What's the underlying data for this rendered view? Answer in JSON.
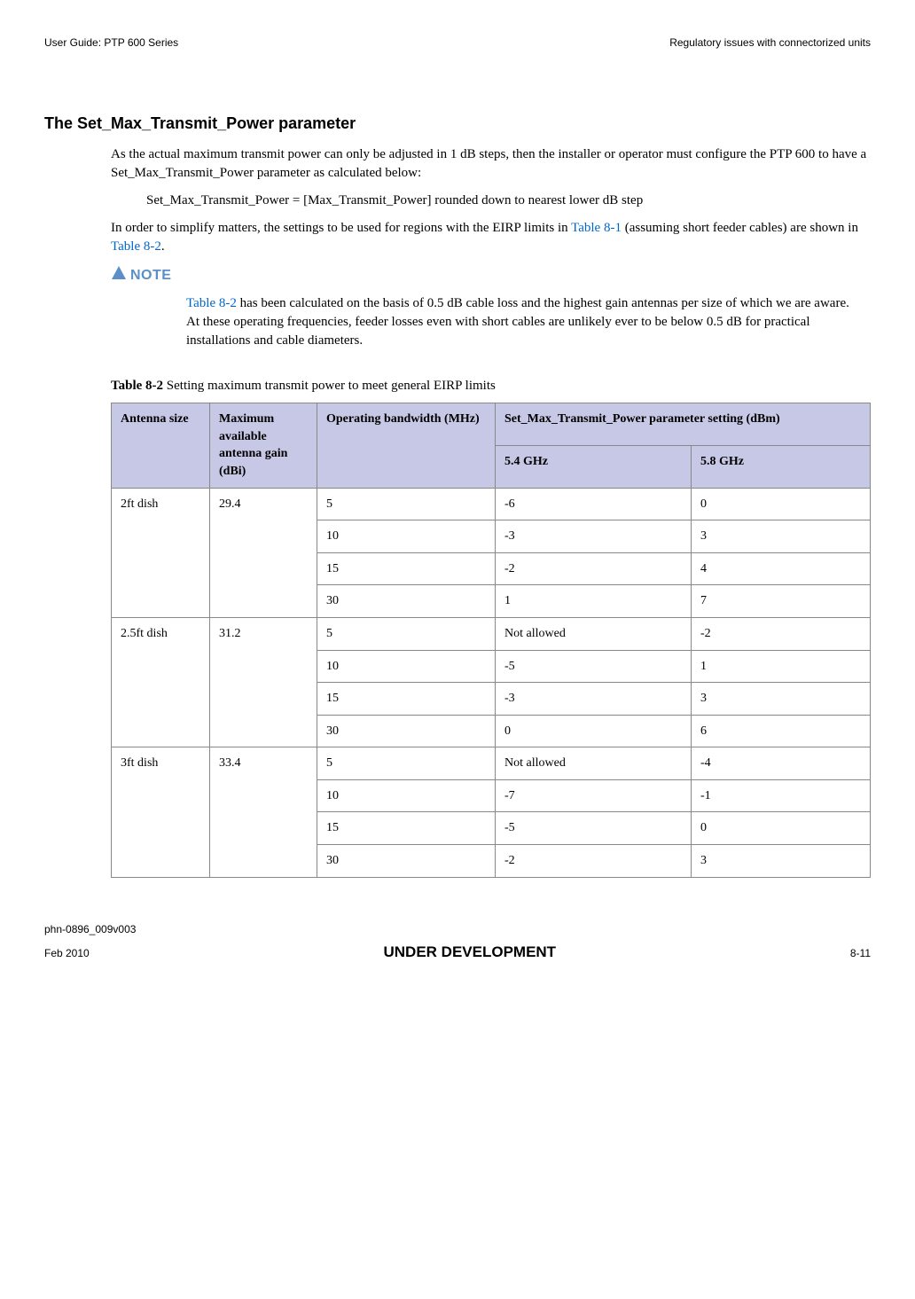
{
  "header": {
    "left": "User Guide: PTP 600 Series",
    "right": "Regulatory issues with connectorized units"
  },
  "section": {
    "heading": "The Set_Max_Transmit_Power parameter",
    "para1": "As the actual maximum transmit power can only be adjusted in 1 dB steps, then the installer or operator must configure the PTP 600 to have a Set_Max_Transmit_Power parameter as calculated below:",
    "formula": "Set_Max_Transmit_Power = [Max_Transmit_Power] rounded down to nearest lower dB step",
    "para2_pre": "In order to simplify matters, the settings to be used for regions with the EIRP limits in ",
    "para2_link1": "Table 8-1",
    "para2_mid": " (assuming short feeder cables) are shown in ",
    "para2_link2": "Table 8-2",
    "para2_post": "."
  },
  "note": {
    "label": "NOTE",
    "link": "Table 8-2",
    "body_post": " has been calculated on the basis of 0.5 dB cable loss and the highest gain antennas per size of which we are aware.  At these operating frequencies, feeder losses even with short cables are unlikely ever to be below 0.5 dB for practical installations and cable diameters."
  },
  "table": {
    "caption_label": "Table 8-2",
    "caption_text": "  Setting maximum transmit power to meet general EIRP limits",
    "headers": {
      "col1": "Antenna size",
      "col2": "Maximum available antenna gain (dBi)",
      "col3": "Operating bandwidth (MHz)",
      "col4_top": "Set_Max_Transmit_Power parameter setting (dBm)",
      "col4_a": "5.4 GHz",
      "col4_b": "5.8 GHz"
    },
    "rows": [
      {
        "size": "2ft dish",
        "gain": "29.4",
        "bw": "5",
        "v54": "-6",
        "v58": "0"
      },
      {
        "size": "",
        "gain": "",
        "bw": "10",
        "v54": "-3",
        "v58": "3"
      },
      {
        "size": "",
        "gain": "",
        "bw": "15",
        "v54": "-2",
        "v58": "4"
      },
      {
        "size": "",
        "gain": "",
        "bw": "30",
        "v54": "1",
        "v58": "7"
      },
      {
        "size": "2.5ft dish",
        "gain": "31.2",
        "bw": "5",
        "v54": "Not allowed",
        "v58": "-2"
      },
      {
        "size": "",
        "gain": "",
        "bw": "10",
        "v54": "-5",
        "v58": "1"
      },
      {
        "size": "",
        "gain": "",
        "bw": "15",
        "v54": "-3",
        "v58": "3"
      },
      {
        "size": "",
        "gain": "",
        "bw": "30",
        "v54": "0",
        "v58": "6"
      },
      {
        "size": "3ft dish",
        "gain": "33.4",
        "bw": "5",
        "v54": "Not allowed",
        "v58": "-4"
      },
      {
        "size": "",
        "gain": "",
        "bw": "10",
        "v54": "-7",
        "v58": "-1"
      },
      {
        "size": "",
        "gain": "",
        "bw": "15",
        "v54": "-5",
        "v58": "0"
      },
      {
        "size": "",
        "gain": "",
        "bw": "30",
        "v54": "-2",
        "v58": "3"
      }
    ]
  },
  "footer": {
    "doc": "phn-0896_009v003",
    "date": "Feb 2010",
    "center": "UNDER DEVELOPMENT",
    "page": "8-11"
  }
}
